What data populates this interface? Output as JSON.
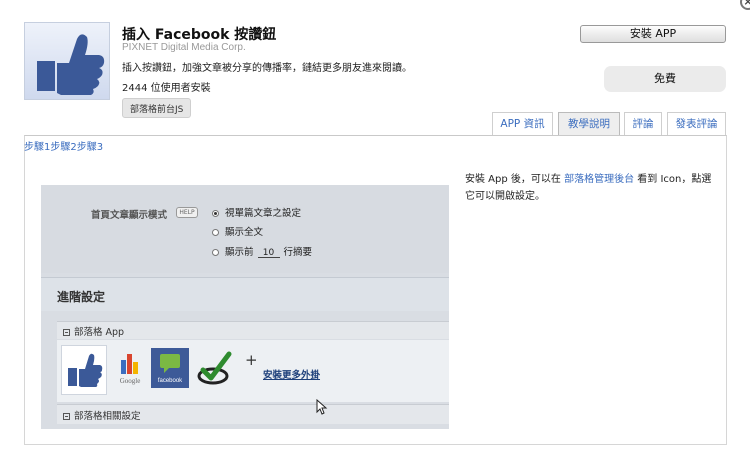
{
  "header": {
    "title": "插入 Facebook 按讚鈕",
    "company": "PIXNET Digital Media Corp.",
    "description": "插入按讚鈕，加強文章被分享的傳播率，鏈結更多朋友進來閱讀。",
    "installs": "2444 位使用者安裝",
    "tag": "部落格前台JS",
    "logo_icon": "thumbs-up-icon"
  },
  "actions": {
    "install_label": "安裝 APP",
    "price_label": "免費"
  },
  "tabs": [
    {
      "label": "APP 資訊",
      "active": false
    },
    {
      "label": "教學說明",
      "active": true
    },
    {
      "label": "評論",
      "active": false
    },
    {
      "label": "發表評論",
      "active": false
    }
  ],
  "steps": [
    "步驟1",
    "步驟2",
    "步驟3"
  ],
  "help": {
    "part1": "安裝 App 後，可以在",
    "link": "部落格管理後台",
    "part2": "看到 Icon，點選它可以開啟設定。"
  },
  "screenshot": {
    "field_label": "首頁文章顯示模式",
    "help_badge": "HELP",
    "options": [
      "視單篇文章之設定",
      "顯示全文",
      "顯示前"
    ],
    "option_suffix": "行摘要",
    "summary_lines": "10",
    "advanced_title": "進階設定",
    "section_apps": "部落格 App",
    "chart_caption": "Google",
    "fb_caption": "facebook",
    "more_link": "安裝更多外掛",
    "section_related": "部落格相關設定"
  },
  "colors": {
    "link": "#3b6dbf",
    "facebook_blue": "#3d5a98"
  }
}
